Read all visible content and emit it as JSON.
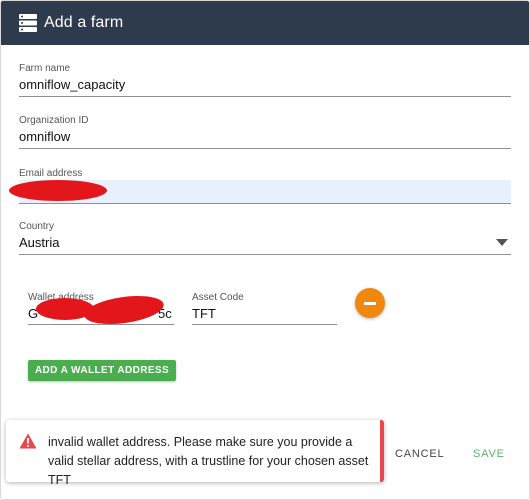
{
  "dialog": {
    "title": "Add a farm"
  },
  "fields": {
    "farm_name": {
      "label": "Farm name",
      "value": "omniflow_capacity"
    },
    "organization_id": {
      "label": "Organization ID",
      "value": "omniflow"
    },
    "email": {
      "label": "Email address",
      "value": ""
    },
    "country": {
      "label": "Country",
      "value": "Austria"
    }
  },
  "wallet": {
    "address_label": "Wallet address",
    "address_prefix": "G",
    "address_suffix": "5c",
    "asset_label": "Asset Code",
    "asset_value": "TFT"
  },
  "buttons": {
    "add_wallet": "ADD A WALLET ADDRESS",
    "cancel": "CANCEL",
    "save": "SAVE"
  },
  "toast": {
    "message": "invalid wallet address. Please make sure you provide a valid stellar address, with a trustline for your chosen asset TFT",
    "icon": "warning-icon"
  },
  "colors": {
    "titlebar": "#2d3b4c",
    "add_wallet_bg": "#4aae4f",
    "remove_btn": "#f0870f",
    "toast_accent": "#e8474c",
    "save_text": "#57b36a",
    "email_autofill_bg": "#e8f0fe"
  }
}
